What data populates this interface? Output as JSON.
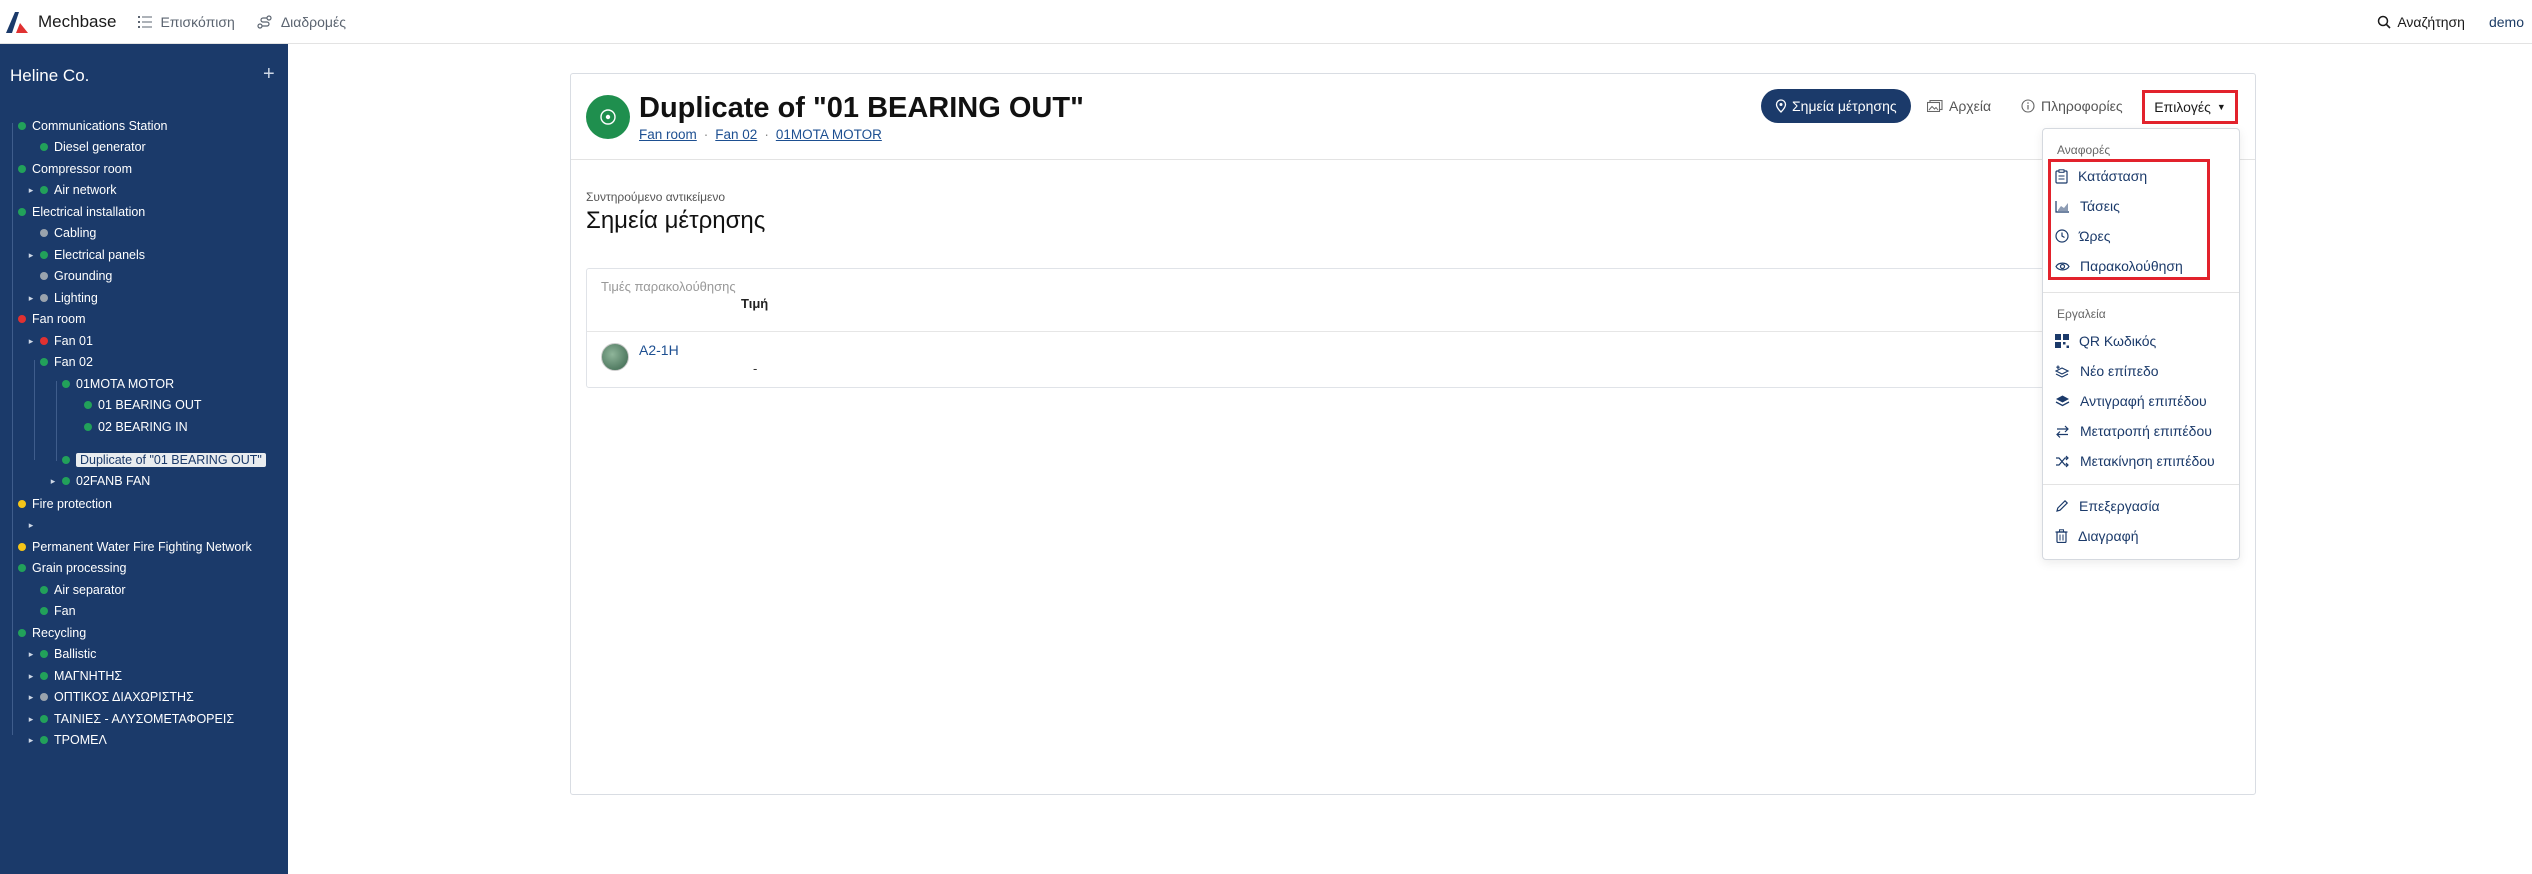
{
  "topbar": {
    "brand": "Mechbase",
    "nav": [
      {
        "label": "Επισκόπιση",
        "icon": "list-icon"
      },
      {
        "label": "Διαδρομές",
        "icon": "route-icon"
      }
    ],
    "search_label": "Αναζήτηση",
    "user": "demo"
  },
  "sidebar": {
    "company": "Heline Co.",
    "add": "+",
    "tree": [
      {
        "label": "Communications Station",
        "status": "#22a15a",
        "caret": ""
      },
      {
        "label": "Diesel generator",
        "status": "#22a15a",
        "caret": ""
      },
      {
        "label": "Compressor room",
        "status": "#22a15a",
        "caret": ""
      },
      {
        "label": "Air network",
        "status": "#22a15a",
        "caret": "▸"
      },
      {
        "label": "Electrical installation",
        "status": "#22a15a",
        "caret": ""
      },
      {
        "label": "Cabling",
        "status": "#9aa3ad",
        "caret": ""
      },
      {
        "label": "Electrical panels",
        "status": "#22a15a",
        "caret": "▸"
      },
      {
        "label": "Grounding",
        "status": "#9aa3ad",
        "caret": ""
      },
      {
        "label": "Lighting",
        "status": "#9aa3ad",
        "caret": "▸"
      },
      {
        "label": "Fan room",
        "status": "#e03131",
        "caret": ""
      },
      {
        "label": "Fan 01",
        "status": "#e03131",
        "caret": "▸"
      },
      {
        "label": "Fan 02",
        "status": "#22a15a",
        "caret": ""
      },
      {
        "label": "01MOTA MOTOR",
        "status": "#22a15a",
        "caret": ""
      },
      {
        "label": "01 BEARING OUT",
        "status": "#22a15a",
        "caret": ""
      },
      {
        "label": "02 BEARING IN",
        "status": "#22a15a",
        "caret": ""
      },
      {
        "label": "Duplicate of \"01 BEARING OUT\"",
        "status": "#22a15a",
        "caret": ""
      },
      {
        "label": "02FANB FAN",
        "status": "#22a15a",
        "caret": "▸"
      },
      {
        "label": "Fire protection",
        "status": "#f5c518",
        "caret": ""
      },
      {
        "label": "",
        "status": "",
        "caret": "▸"
      },
      {
        "label": "Permanent Water Fire Fighting Network",
        "status": "#f5c518",
        "caret": ""
      },
      {
        "label": "Grain processing",
        "status": "#22a15a",
        "caret": ""
      },
      {
        "label": "Air separator",
        "status": "#22a15a",
        "caret": ""
      },
      {
        "label": "Fan",
        "status": "#22a15a",
        "caret": ""
      },
      {
        "label": "Recycling",
        "status": "#22a15a",
        "caret": ""
      },
      {
        "label": "Ballistic",
        "status": "#22a15a",
        "caret": "▸"
      },
      {
        "label": "ΜΑΓΝΗΤΗΣ",
        "status": "#22a15a",
        "caret": "▸"
      },
      {
        "label": "ΟΠΤΙΚΟΣ ΔΙΑΧΩΡΙΣΤΗΣ",
        "status": "#9aa3ad",
        "caret": "▸"
      },
      {
        "label": "ΤΑΙΝΙΕΣ - ΑΛΥΣΟΜΕΤΑΦΟΡΕΙΣ",
        "status": "#22a15a",
        "caret": "▸"
      },
      {
        "label": "ΤΡΟΜΕΛ",
        "status": "#22a15a",
        "caret": "▸"
      }
    ]
  },
  "header": {
    "title": "Duplicate of \"01 BEARING OUT\"",
    "breadcrumbs": [
      "Fan room",
      "Fan 02",
      "01MOTA MOTOR"
    ],
    "btn_points": "Σημεία μέτρησης",
    "btn_files": "Αρχεία",
    "btn_info": "Πληροφορίες",
    "btn_options": "Επιλογές"
  },
  "content": {
    "subtitle": "Συντηρούμενο αντικείμενο",
    "section_title": "Σημεία μέτρησης",
    "table_caption": "Τιμές παρακολούθησης",
    "column_value": "Τιμή",
    "row_name": "A2-1H",
    "row_value": "-"
  },
  "dropdown": {
    "reports_header": "Αναφορές",
    "reports": [
      "Κατάσταση",
      "Τάσεις",
      "Ώρες",
      "Παρακολούθηση"
    ],
    "tools_header": "Εργαλεία",
    "tools": [
      "QR Κωδικός",
      "Νέο επίπεδο",
      "Αντιγραφή επιπέδου",
      "Μετατροπή επιπέδου",
      "Μετακίνηση επιπέδου"
    ],
    "edit": "Επεξεργασία",
    "delete": "Διαγραφή"
  },
  "colors": {
    "sidebar_bg": "#1b3a6a",
    "primary": "#1b3a6a",
    "status_ok": "#22a15a",
    "highlight": "#e2222c"
  }
}
